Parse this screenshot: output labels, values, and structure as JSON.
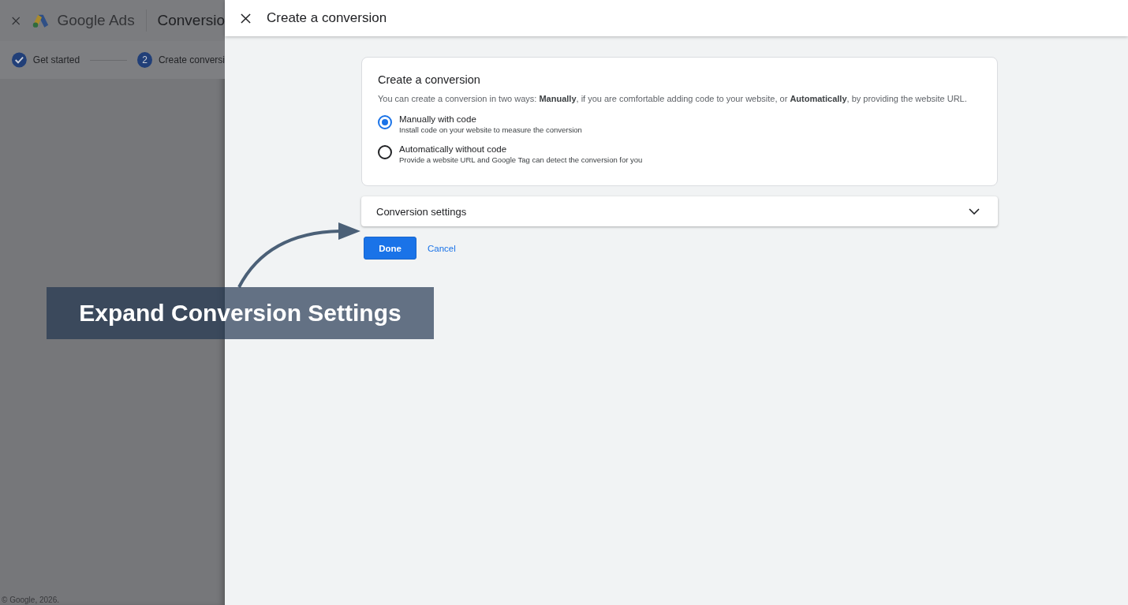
{
  "background_page": {
    "app_name": "Google Ads",
    "page_title": "Conversio",
    "steps": [
      {
        "label": "Get started",
        "done": true
      },
      {
        "label": "Create conversi",
        "done": false,
        "number": "2"
      }
    ],
    "footer": "© Google, 2026."
  },
  "panel": {
    "title": "Create a conversion"
  },
  "card": {
    "title": "Create a conversion",
    "description": "You can create a conversion in two ways: **Manually**, if you are comfortable adding code to your website, or **Automatically**, by providing the website URL.",
    "options": [
      {
        "label": "Manually with code",
        "hint": "Install code on your website to measure the conversion",
        "selected": true
      },
      {
        "label": "Automatically without code",
        "hint": "Provide a website URL and Google Tag can detect the conversion for you",
        "selected": false
      }
    ]
  },
  "section": {
    "title": "Conversion settings",
    "expanded": false
  },
  "buttons": {
    "primary": "Done",
    "secondary": "Cancel"
  },
  "callout": "Expand Conversion Settings"
}
